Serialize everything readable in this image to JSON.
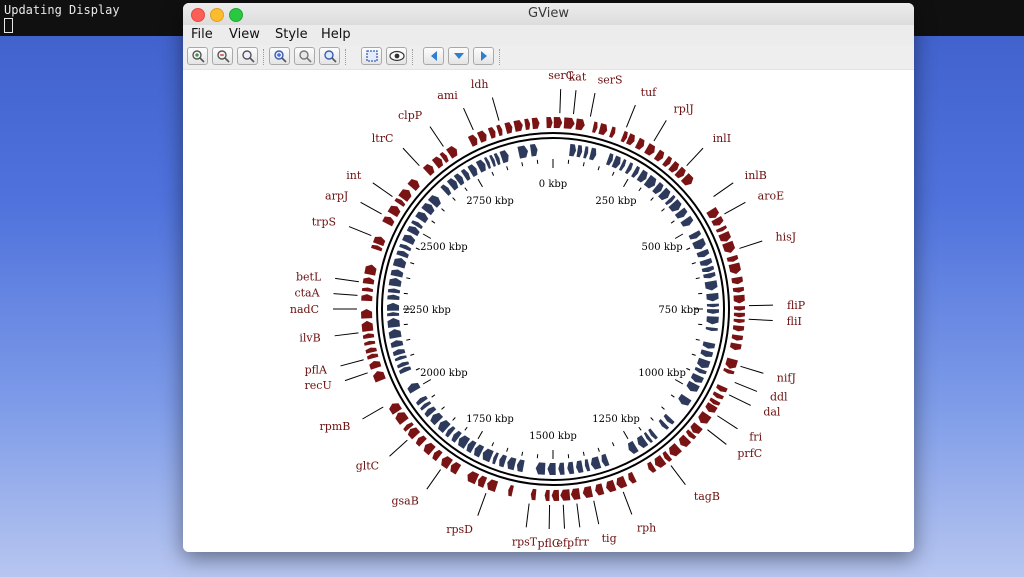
{
  "terminal": {
    "text": "Updating Display"
  },
  "window": {
    "title": "GView"
  },
  "menu": [
    "File",
    "View",
    "Style",
    "Help"
  ],
  "toolbar": {
    "buttons": [
      {
        "name": "zoom-in-green-icon",
        "color": "#2e8b3a"
      },
      {
        "name": "zoom-out-red-icon",
        "color": "#c0392b"
      },
      {
        "name": "zoom-reset-icon",
        "color": "#555555"
      },
      {
        "name": "zoom-in-icon",
        "color": "#3a5fb0"
      },
      {
        "name": "zoom-out-icon",
        "color": "#777777"
      },
      {
        "name": "zoom-fit-icon",
        "color": "#3a5fb0"
      },
      {
        "name": "select-region-icon",
        "color": "#3a5fb0"
      },
      {
        "name": "eye-icon",
        "color": "#333333"
      },
      {
        "name": "arrow-left-icon",
        "color": "#2f7fd0"
      },
      {
        "name": "arrow-down-icon",
        "color": "#2f7fd0"
      },
      {
        "name": "arrow-right-icon",
        "color": "#2f7fd0"
      }
    ]
  },
  "genome_map": {
    "colors": {
      "forward": "#7a1414",
      "reverse": "#2e3a5c",
      "label": "#6b1010",
      "backbone": "#000000"
    },
    "genome_length_kbp": 3000,
    "scale_labels": [
      "0 kbp",
      "250 kbp",
      "500 kbp",
      "750 kbp",
      "1000 kbp",
      "1250 kbp",
      "1500 kbp",
      "1750 kbp",
      "2000 kbp",
      "2250 kbp",
      "2500 kbp",
      "2750 kbp"
    ],
    "gene_labels": [
      {
        "name": "serC",
        "angle": 2
      },
      {
        "name": "kat",
        "angle": 6
      },
      {
        "name": "serS",
        "angle": 11
      },
      {
        "name": "tuf",
        "angle": 22
      },
      {
        "name": "rplJ",
        "angle": 31
      },
      {
        "name": "inlI",
        "angle": 43
      },
      {
        "name": "inlB",
        "angle": 55
      },
      {
        "name": "aroE",
        "angle": 61
      },
      {
        "name": "hisJ",
        "angle": 72
      },
      {
        "name": "fliP",
        "angle": 89
      },
      {
        "name": "fliI",
        "angle": 93
      },
      {
        "name": "nifJ",
        "angle": 107
      },
      {
        "name": "ddl",
        "angle": 112
      },
      {
        "name": "dal",
        "angle": 116
      },
      {
        "name": "fri",
        "angle": 123
      },
      {
        "name": "prfC",
        "angle": 128
      },
      {
        "name": "tagB",
        "angle": 143
      },
      {
        "name": "rph",
        "angle": 159
      },
      {
        "name": "tig",
        "angle": 168
      },
      {
        "name": "frr",
        "angle": 173
      },
      {
        "name": "efp",
        "angle": 177
      },
      {
        "name": "pflC",
        "angle": 181
      },
      {
        "name": "rpsT",
        "angle": 187
      },
      {
        "name": "rpsD",
        "angle": 200
      },
      {
        "name": "gsaB",
        "angle": 215
      },
      {
        "name": "gltC",
        "angle": 228
      },
      {
        "name": "rpmB",
        "angle": 240
      },
      {
        "name": "recU",
        "angle": 251
      },
      {
        "name": "pflA",
        "angle": 255
      },
      {
        "name": "ilvB",
        "angle": 263
      },
      {
        "name": "nadC",
        "angle": 270
      },
      {
        "name": "ctaA",
        "angle": 274
      },
      {
        "name": "betL",
        "angle": 278
      },
      {
        "name": "trpS",
        "angle": 292
      },
      {
        "name": "arpJ",
        "angle": 299
      },
      {
        "name": "int",
        "angle": 305
      },
      {
        "name": "ltrC",
        "angle": 317
      },
      {
        "name": "clpP",
        "angle": 326
      },
      {
        "name": "ami",
        "angle": 336
      },
      {
        "name": "ldh",
        "angle": 344
      }
    ]
  }
}
